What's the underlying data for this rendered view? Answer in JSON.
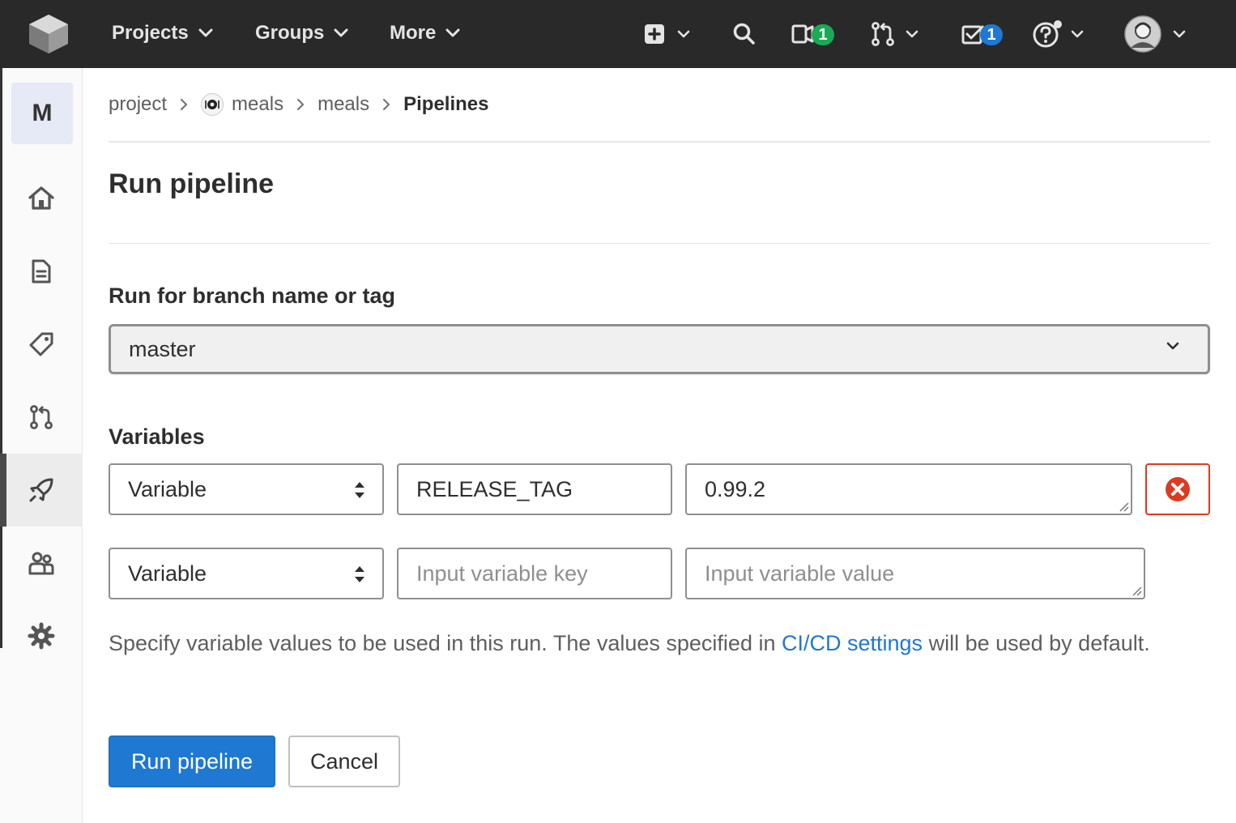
{
  "topbar": {
    "nav": {
      "projects": "Projects",
      "groups": "Groups",
      "more": "More"
    },
    "icons": {
      "new": "plus-square-icon",
      "search": "search-icon",
      "issues": "issues-icon",
      "merge_requests": "merge-request-icon",
      "todos": "todo-icon",
      "help": "help-icon"
    },
    "issues_count": "1",
    "todos_count": "1"
  },
  "sidebar": {
    "project_letter": "M",
    "items": [
      {
        "name": "home",
        "icon": "home-icon"
      },
      {
        "name": "repository",
        "icon": "document-icon"
      },
      {
        "name": "issues",
        "icon": "tag-icon"
      },
      {
        "name": "merge-requests",
        "icon": "merge-request-icon"
      },
      {
        "name": "ci-cd",
        "icon": "rocket-icon",
        "active": true
      },
      {
        "name": "members",
        "icon": "users-icon"
      },
      {
        "name": "settings",
        "icon": "gear-icon"
      }
    ]
  },
  "breadcrumb": {
    "items": [
      "project",
      "meals",
      "meals"
    ],
    "current": "Pipelines"
  },
  "page": {
    "title": "Run pipeline",
    "branch_label": "Run for branch name or tag",
    "branch_value": "master",
    "variables_label": "Variables",
    "variables": [
      {
        "type": "Variable",
        "key": "RELEASE_TAG",
        "value": "0.99.2"
      },
      {
        "type": "Variable",
        "key_placeholder": "Input variable key",
        "value_placeholder": "Input variable value"
      }
    ],
    "help_text_before": "Specify variable values to be used in this run. The values specified in",
    "help_link": "CI/CD settings",
    "help_text_after": "will be used by default.",
    "run_button": "Run pipeline",
    "cancel_button": "Cancel"
  },
  "colors": {
    "topbar": "#292929",
    "primary": "#1f78d1",
    "danger": "#db3b21",
    "badge_green": "#1aaa55",
    "badge_blue": "#1f78d1"
  }
}
